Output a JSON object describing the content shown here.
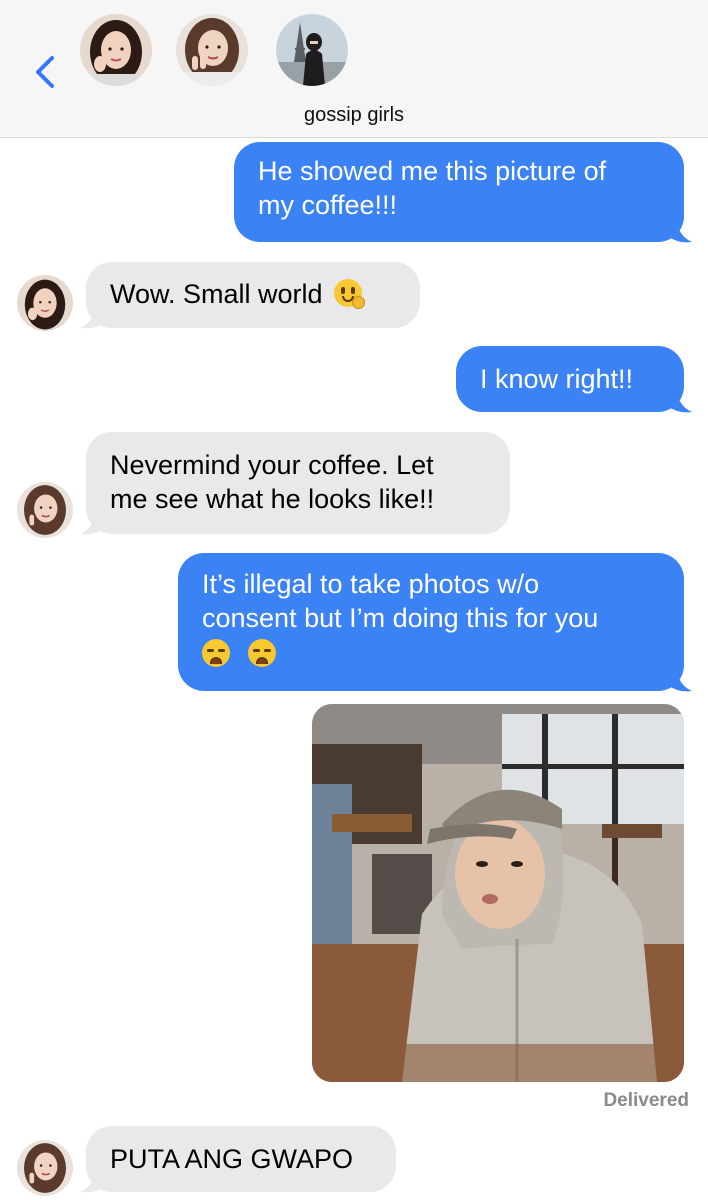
{
  "header": {
    "group_name": "gossip girls",
    "participants": [
      {
        "name": "member-1",
        "avatar_icon": "person-photo"
      },
      {
        "name": "member-2",
        "avatar_icon": "person-photo"
      },
      {
        "name": "member-3",
        "avatar_icon": "person-eiffel-photo"
      }
    ]
  },
  "messages": [
    {
      "direction": "sent",
      "lines": [
        "He showed me this picture of",
        "my coffee!!!"
      ]
    },
    {
      "direction": "received",
      "lines": [
        "Wow. Small world"
      ],
      "emoji": "shushing-face"
    },
    {
      "direction": "sent",
      "lines": [
        "I know right!!"
      ]
    },
    {
      "direction": "received",
      "lines": [
        "Nevermind your coffee. Let",
        "me see what he looks like!!"
      ]
    },
    {
      "direction": "sent",
      "lines": [
        "It’s illegal to take photos w/o",
        "consent but I’m doing this for you"
      ],
      "emoji": [
        "weary-face",
        "weary-face"
      ]
    },
    {
      "direction": "sent",
      "type": "photo",
      "photo_icon": "man-in-hoodie-cafe-photo"
    },
    {
      "direction": "received",
      "lines": [
        "PUTA ANG GWAPO"
      ]
    }
  ],
  "status": {
    "delivered": "Delivered"
  },
  "colors": {
    "sent_bubble": "#3b82f4",
    "received_bubble": "#e9e9eb",
    "accent": "#3478f6"
  }
}
